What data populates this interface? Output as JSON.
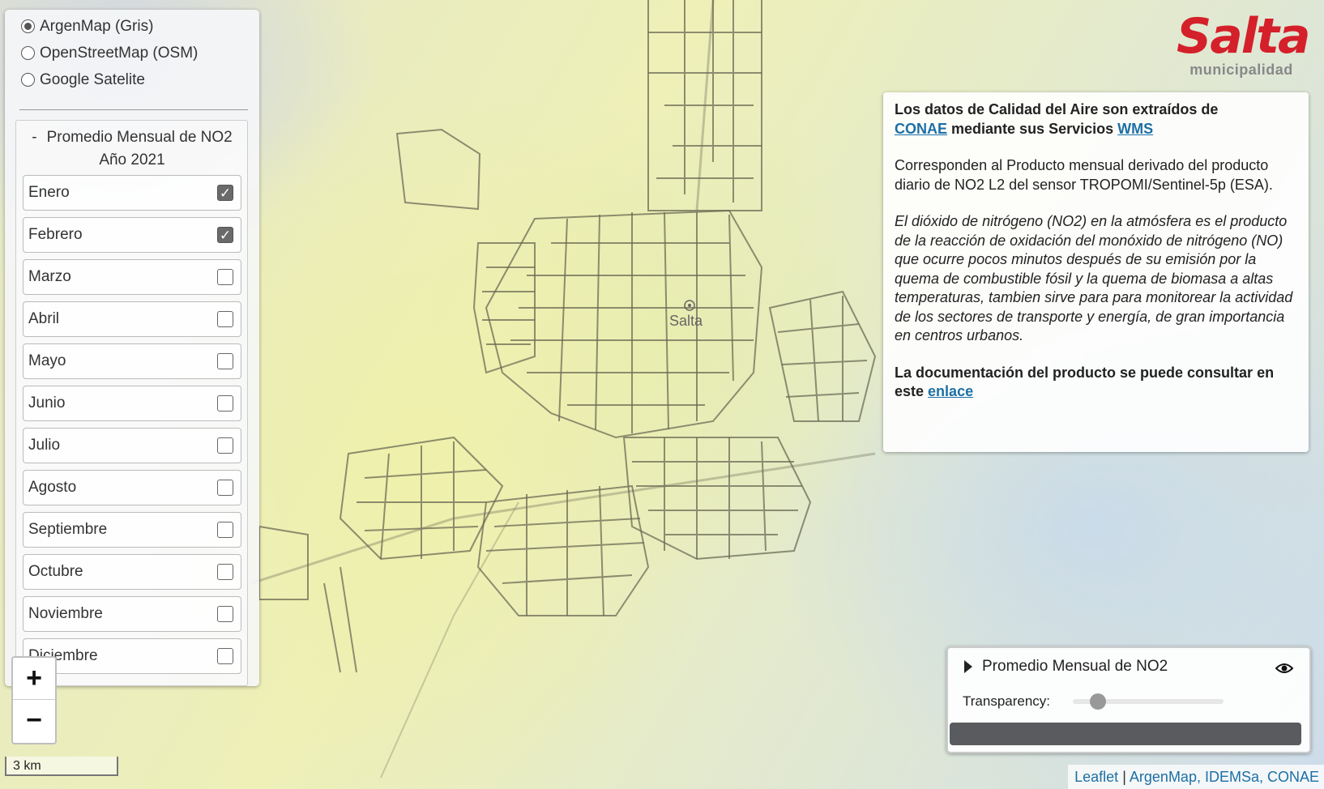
{
  "base_layers": [
    {
      "label": "ArgenMap (Gris)",
      "selected": true
    },
    {
      "label": "OpenStreetMap (OSM)",
      "selected": false
    },
    {
      "label": "Google Satelite",
      "selected": false
    }
  ],
  "overlay_group": {
    "collapse_symbol": "-",
    "title": "Promedio Mensual de NO2",
    "subtitle": "Año 2021",
    "months": [
      {
        "label": "Enero",
        "checked": true
      },
      {
        "label": "Febrero",
        "checked": true
      },
      {
        "label": "Marzo",
        "checked": false
      },
      {
        "label": "Abril",
        "checked": false
      },
      {
        "label": "Mayo",
        "checked": false
      },
      {
        "label": "Junio",
        "checked": false
      },
      {
        "label": "Julio",
        "checked": false
      },
      {
        "label": "Agosto",
        "checked": false
      },
      {
        "label": "Septiembre",
        "checked": false
      },
      {
        "label": "Octubre",
        "checked": false
      },
      {
        "label": "Noviembre",
        "checked": false
      },
      {
        "label": "Diciembre",
        "checked": false
      }
    ]
  },
  "zoom": {
    "in": "+",
    "out": "−"
  },
  "scale_label": "3 km",
  "logo": {
    "wordmark": "Salta",
    "sub": "municipalidad",
    "color": "#d4202a"
  },
  "map_label": "Salta",
  "info": {
    "p1_part1": "Los datos de Calidad del Aire son extraídos de",
    "p1_link1": "CONAE",
    "p1_part2": "mediante sus Servicios",
    "p1_link2": "WMS",
    "p2": "Corresponden al Producto mensual derivado del producto diario de NO2 L2 del sensor TROPOMI/Sentinel-5p (ESA).",
    "p3": "El dióxido de nitrógeno (NO2) en la atmósfera es el producto de la reacción de oxidación del monóxido de nitrógeno (NO) que ocurre pocos minutos después de su emisión por la quema de combustible fósil y la quema de biomasa a altas temperaturas, tambien sirve para para monitorear la actividad de los sectores de transporte y energía, de gran importancia en centros urbanos.",
    "p4_part1": "La documentación del producto se puede consultar en este",
    "p4_link": "enlace"
  },
  "legend": {
    "title": "Promedio Mensual de NO2",
    "transparency_label": "Transparency:",
    "transparency_value": 0.1
  },
  "attribution": {
    "leaflet": "Leaflet",
    "separator": "|",
    "argenmap": "ArgenMap",
    "rest": ", IDEMSa, CONAE"
  }
}
